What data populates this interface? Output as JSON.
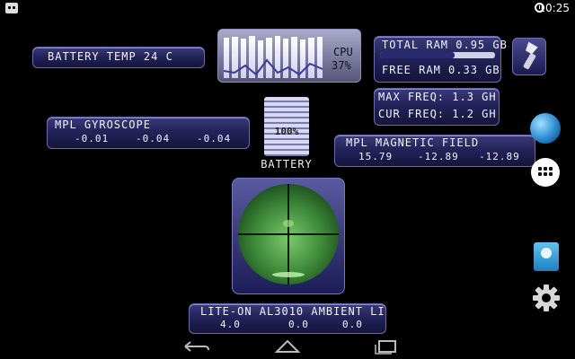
{
  "status": {
    "time": "10:25"
  },
  "battery_temp": {
    "label": "BATTERY TEMP 24 C"
  },
  "cpu": {
    "label": "CPU",
    "value": "37%"
  },
  "ram": {
    "total": "TOTAL RAM 0.95 GB",
    "free": "FREE RAM 0.33 GB"
  },
  "freq": {
    "max": "MAX FREQ: 1.3 GH",
    "cur": "CUR FREQ: 1.2 GH"
  },
  "gyro": {
    "label": "MPL GYROSCOPE",
    "x": "-0.01",
    "y": "-0.04",
    "z": "-0.04"
  },
  "battery": {
    "value": "100%",
    "label": "BATTERY"
  },
  "magnetic": {
    "label": "MPL MAGNETIC FIELD",
    "x": "15.79",
    "y": "-12.89",
    "z": "-12.89"
  },
  "ambient": {
    "label": "LITE-ON AL3010 AMBIENT LI",
    "a": "4.0",
    "b": "0.0",
    "c": "0.0"
  },
  "icons": {
    "flashlight": "flashlight-icon",
    "globe": "globe-icon",
    "apps": "app-drawer-icon",
    "contacts": "contacts-icon",
    "settings": "settings-gear-icon",
    "back": "back-icon",
    "home": "home-icon",
    "recents": "recents-icon"
  },
  "colors": {
    "panel": "#23235a",
    "radar": "#3f8a3a",
    "background": "#000000"
  }
}
